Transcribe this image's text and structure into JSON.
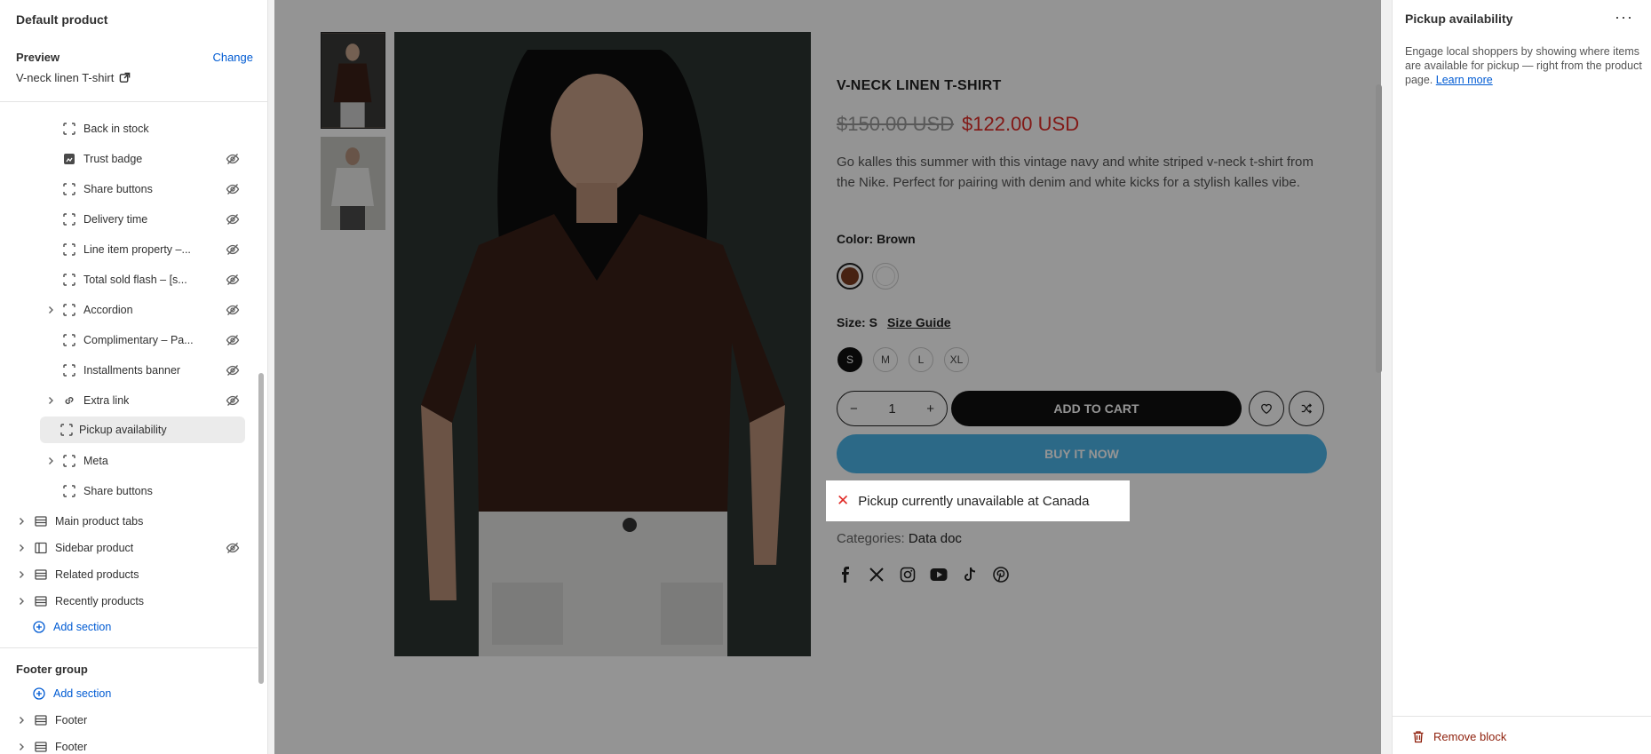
{
  "sidebar": {
    "title": "Default product",
    "preview_label": "Preview",
    "change_label": "Change",
    "product_name": "V-neck linen T-shirt",
    "blocks": [
      {
        "label": "Back in stock",
        "icon": "block-icon",
        "hidden": false
      },
      {
        "label": "Trust badge",
        "icon": "image-block-icon",
        "hidden": true
      },
      {
        "label": "Share buttons",
        "icon": "block-icon",
        "hidden": true
      },
      {
        "label": "Delivery time",
        "icon": "block-icon",
        "hidden": true
      },
      {
        "label": "Line item property –...",
        "icon": "block-icon",
        "hidden": true
      },
      {
        "label": "Total sold flash – [s...",
        "icon": "block-icon",
        "hidden": true
      },
      {
        "label": "Accordion",
        "icon": "block-icon",
        "hidden": true
      },
      {
        "label": "Complimentary – Pa...",
        "icon": "block-icon",
        "hidden": true
      },
      {
        "label": "Installments banner",
        "icon": "block-icon",
        "hidden": true
      },
      {
        "label": "Extra link",
        "icon": "link-icon",
        "hidden": true
      },
      {
        "label": "Pickup availability",
        "icon": "block-icon",
        "hidden": false
      },
      {
        "label": "Meta",
        "icon": "block-icon",
        "hidden": false
      },
      {
        "label": "Share buttons",
        "icon": "block-icon",
        "hidden": false
      }
    ],
    "sections": [
      {
        "label": "Main product tabs",
        "hidden": false
      },
      {
        "label": "Sidebar product",
        "hidden": true
      },
      {
        "label": "Related products",
        "hidden": false
      },
      {
        "label": "Recently products",
        "hidden": false
      }
    ],
    "add_section": "Add section",
    "footer_group": "Footer group",
    "footer_add_section": "Add section",
    "footer_items": [
      "Footer",
      "Footer"
    ]
  },
  "product": {
    "title": "V-NECK LINEN T-SHIRT",
    "old_price": "$150.00 USD",
    "new_price": "$122.00 USD",
    "description": "Go kalles this summer with this vintage navy and white striped v-neck t-shirt from the Nike. Perfect for pairing with denim and white kicks for a stylish kalles vibe.",
    "color_label": "Color: Brown",
    "swatches": [
      "#7a3b1f",
      "#ffffff"
    ],
    "size_label": "Size: S",
    "size_guide": "Size Guide",
    "sizes": [
      "S",
      "M",
      "L",
      "XL"
    ],
    "selected_size": "S",
    "quantity": "1",
    "qty_minus": "−",
    "qty_plus": "+",
    "add_to_cart": "ADD TO CART",
    "buy_now": "BUY IT NOW",
    "pickup_text": "Pickup currently unavailable at Canada",
    "pickup_icon": "✕",
    "categories_label": "Categories:",
    "categories_value": "Data doc",
    "socials": [
      "facebook-icon",
      "x-icon",
      "instagram-icon",
      "youtube-icon",
      "tiktok-icon",
      "pinterest-icon"
    ]
  },
  "right_panel": {
    "title": "Pickup availability",
    "more": "···",
    "description": "Engage local shoppers by showing where items are available for pickup — right from the product page.",
    "learn_more": "Learn more",
    "remove_block": "Remove block"
  },
  "colors": {
    "accent_blue": "#005bd3",
    "buy_now": "#4db5e9",
    "sale_red": "#e02b27",
    "remove_red": "#8e1f0b"
  }
}
